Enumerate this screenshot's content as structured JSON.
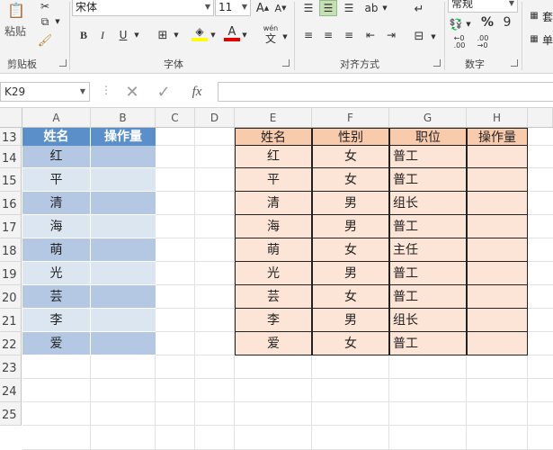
{
  "ribbon": {
    "clipboard": {
      "paste_label": "粘贴",
      "group_label": "剪贴板"
    },
    "font": {
      "font_name": "宋体",
      "font_size": "11",
      "group_label": "字体",
      "wen_label": "wén",
      "wen_char": "文"
    },
    "alignment": {
      "group_label": "对齐方式"
    },
    "number": {
      "format": "常规",
      "percent": "%",
      "comma": "9",
      "group_label": "数字"
    },
    "styles": {
      "item1": "套",
      "item2": "单"
    }
  },
  "formula_bar": {
    "name_box": "K29",
    "fx": "fx",
    "value": ""
  },
  "columns": [
    "A",
    "B",
    "C",
    "D",
    "E",
    "F",
    "G",
    "H"
  ],
  "rows": [
    "13",
    "14",
    "15",
    "16",
    "17",
    "18",
    "19",
    "20",
    "21",
    "22",
    "23",
    "24",
    "25"
  ],
  "left_table": {
    "headers": [
      "姓名",
      "操作量"
    ],
    "names": [
      "红",
      "平",
      "清",
      "海",
      "萌",
      "光",
      "芸",
      "李",
      "爱"
    ]
  },
  "right_table": {
    "headers": [
      "姓名",
      "性别",
      "职位",
      "操作量"
    ],
    "rows": [
      [
        "红",
        "女",
        "普工",
        ""
      ],
      [
        "平",
        "女",
        "普工",
        ""
      ],
      [
        "清",
        "男",
        "组长",
        ""
      ],
      [
        "海",
        "男",
        "普工",
        ""
      ],
      [
        "萌",
        "女",
        "主任",
        ""
      ],
      [
        "光",
        "男",
        "普工",
        ""
      ],
      [
        "芸",
        "女",
        "普工",
        ""
      ],
      [
        "李",
        "男",
        "组长",
        ""
      ],
      [
        "爱",
        "女",
        "普工",
        ""
      ]
    ]
  },
  "colors": {
    "blue_header": "#5b8fc9",
    "blue_dark": "#b4c8e4",
    "blue_light": "#dce6f1",
    "peach_header": "#f8cbad",
    "peach": "#fce4d6"
  }
}
